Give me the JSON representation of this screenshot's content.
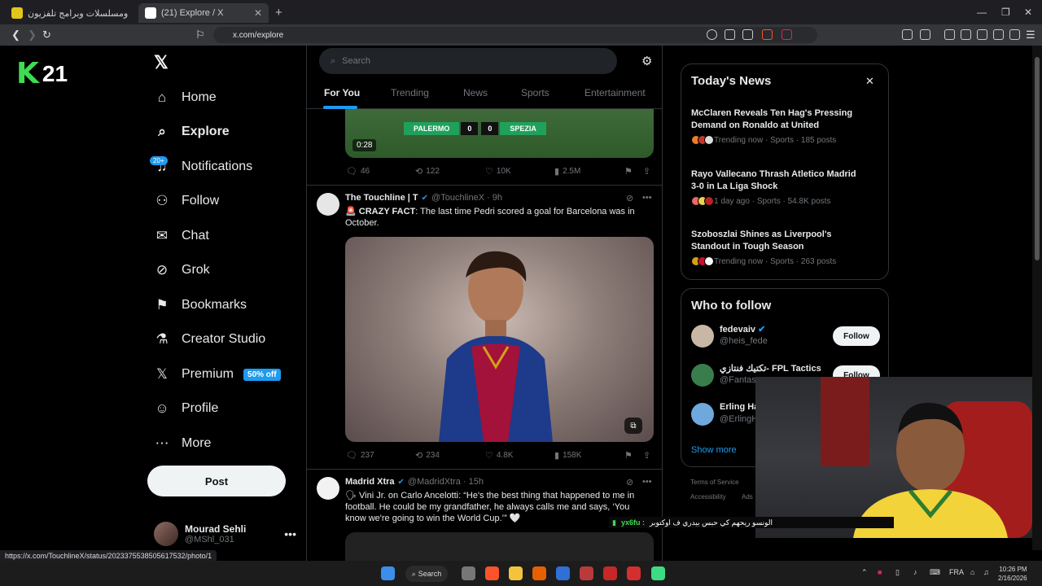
{
  "browser": {
    "tabs": [
      {
        "title": "مشاهدة أفلام ومسلسلات وبرامج تلفزيون",
        "fav_color": "#e3c61a"
      },
      {
        "title": "(21) Explore / X",
        "fav_color": "#ffffff"
      }
    ],
    "url": "x.com/explore",
    "status_url": "https://x.com/TouchlineX/status/2023375538505617532/photo/1"
  },
  "overlay_logo": {
    "letter": "K",
    "number": "21"
  },
  "sidebar": {
    "items": [
      {
        "label": "Home",
        "icon": "home-icon",
        "glyph": "⌂"
      },
      {
        "label": "Explore",
        "icon": "search-icon",
        "glyph": "⌕"
      },
      {
        "label": "Notifications",
        "icon": "bell-icon",
        "glyph": "♫"
      },
      {
        "label": "Follow",
        "icon": "person-add-icon",
        "glyph": "⚇"
      },
      {
        "label": "Chat",
        "icon": "mail-icon",
        "glyph": "✉"
      },
      {
        "label": "Grok",
        "icon": "grok-icon",
        "glyph": "⊘"
      },
      {
        "label": "Bookmarks",
        "icon": "bookmark-icon",
        "glyph": "⚑"
      },
      {
        "label": "Creator Studio",
        "icon": "flask-icon",
        "glyph": "⚗"
      },
      {
        "label": "Premium",
        "icon": "x-logo-icon",
        "glyph": "𝕏"
      },
      {
        "label": "Profile",
        "icon": "person-icon",
        "glyph": "☺"
      },
      {
        "label": "More",
        "icon": "more-circle-icon",
        "glyph": "⋯"
      }
    ],
    "notifications_badge": "20+",
    "premium_badge": "50% off",
    "post_label": "Post",
    "account": {
      "name": "Mourad Sehli",
      "handle": "@MShl_031"
    }
  },
  "explore": {
    "search_placeholder": "Search",
    "tabs": [
      "For You",
      "Trending",
      "News",
      "Sports",
      "Entertainment"
    ],
    "video": {
      "duration": "0:28",
      "home": "PALERMO",
      "score_home": "0",
      "score_away": "0",
      "away": "SPEZIA"
    },
    "tweet1_stats": {
      "replies": "46",
      "reposts": "122",
      "likes": "10K",
      "views": "2.5M"
    },
    "tweet2": {
      "name": "The Touchline | T",
      "handle": "@TouchlineX",
      "time": "· 9h",
      "label": "CRAZY FACT",
      "text": ": The last time Pedri scored a goal for Barcelona was in October.",
      "replies": "237",
      "reposts": "234",
      "likes": "4.8K",
      "views": "158K"
    },
    "tweet3": {
      "name": "Madrid Xtra",
      "handle": "@MadridXtra",
      "time": "· 15h",
      "text": "Vini Jr. on Carlo Ancelotti: “He's the best thing that happened to me in football. He could be my grandfather, he always calls me and says, ‘You know we're going to win the World Cup.’” 🤍"
    }
  },
  "news": {
    "title": "Today's News",
    "items": [
      {
        "title": "McClaren Reveals Ten Hag's Pressing Demand on Ronaldo at United",
        "meta": "Trending now · Sports · 185 posts"
      },
      {
        "title": "Rayo Vallecano Thrash Atletico Madrid 3-0 in La Liga Shock",
        "meta": "1 day ago · Sports · 54.8K posts"
      },
      {
        "title": "Szoboszlai Shines as Liverpool's Standout in Tough Season",
        "meta": "Trending now · Sports · 263 posts"
      }
    ]
  },
  "who_to_follow": {
    "title": "Who to follow",
    "follow_label": "Follow",
    "show_more": "Show more",
    "accounts": [
      {
        "name": "fedevaiv",
        "handle": "@heis_fede"
      },
      {
        "name": "تكتيك فنتازي- FPL Tactics",
        "handle": "@Fantas"
      },
      {
        "name": "Erling Ha",
        "handle": "@ErlingH"
      }
    ],
    "footer": [
      "Terms of Service",
      "Accessibility",
      "Ads"
    ]
  },
  "stream_ticker": {
    "code": "yx6fu :",
    "message": "الونسو ريحهم كي حبس بيدري ف اوكتوبر"
  },
  "taskbar": {
    "search_label": "Search",
    "lang": "FRA",
    "time": "10:26 PM",
    "date": "2/16/2026"
  }
}
